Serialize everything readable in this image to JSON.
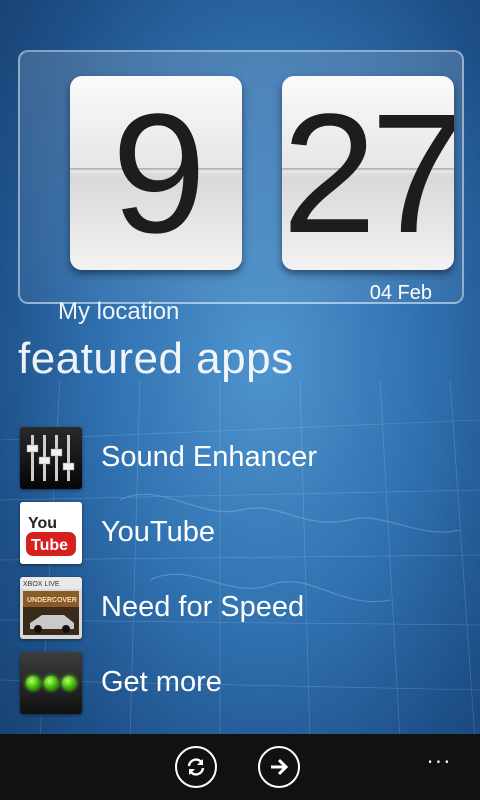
{
  "clock": {
    "hour": "9",
    "minute": "27",
    "location": "My location",
    "date": "04 Feb"
  },
  "featured": {
    "title": "featured apps",
    "apps": [
      {
        "label": "Sound Enhancer",
        "icon": "sound-enhancer-icon"
      },
      {
        "label": "YouTube",
        "icon": "youtube-icon",
        "icon_text_top": "You",
        "icon_text_bottom": "Tube"
      },
      {
        "label": "Need for Speed",
        "icon": "need-for-speed-icon",
        "icon_badge": "XBOX LIVE",
        "icon_caption": "UNDERCOVER"
      },
      {
        "label": "Get more",
        "icon": "get-more-icon"
      }
    ]
  },
  "app_bar": {
    "refresh": "refresh-icon",
    "next": "arrow-right-icon",
    "more": "..."
  }
}
